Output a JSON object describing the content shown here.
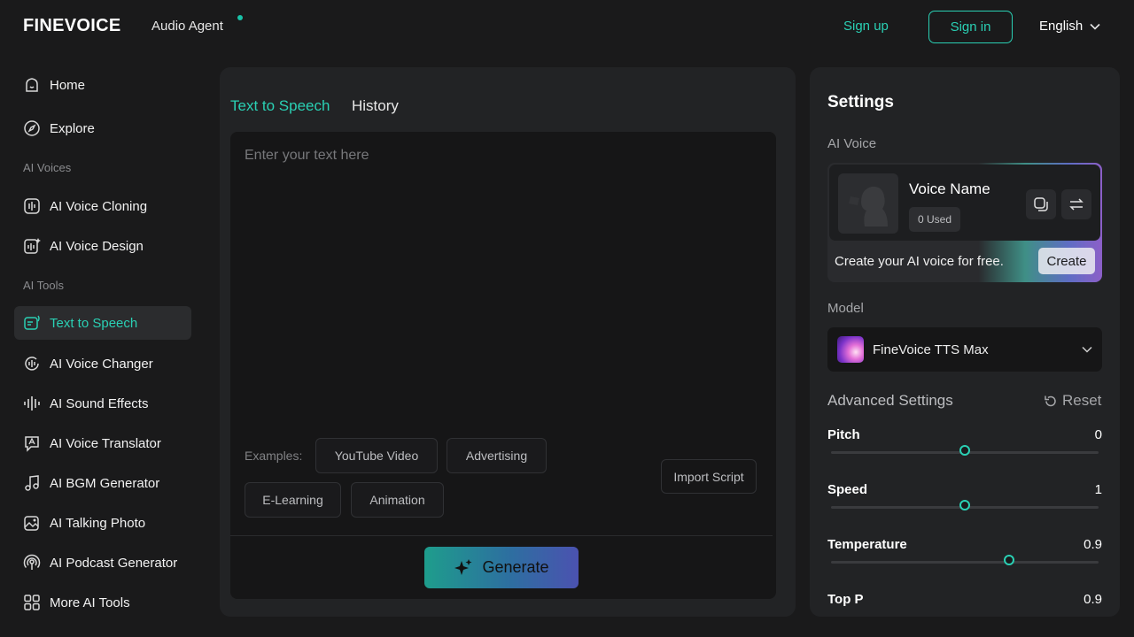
{
  "header": {
    "logo": "FINEVOICE",
    "agent_label": "Audio Agent",
    "signup_label": "Sign up",
    "signin_label": "Sign in",
    "language": "English"
  },
  "sidebar": {
    "items_top": [
      {
        "label": "Home",
        "icon": "home-icon"
      },
      {
        "label": "Explore",
        "icon": "compass-icon"
      }
    ],
    "section_voices": "AI Voices",
    "items_voices": [
      {
        "label": "AI Voice Cloning",
        "icon": "voice-clone-icon"
      },
      {
        "label": "AI Voice Design",
        "icon": "voice-design-icon"
      }
    ],
    "section_tools": "AI Tools",
    "items_tools": [
      {
        "label": "Text to Speech",
        "icon": "tts-icon",
        "active": true
      },
      {
        "label": "AI Voice Changer",
        "icon": "voice-changer-icon"
      },
      {
        "label": "AI Sound Effects",
        "icon": "sound-effects-icon"
      },
      {
        "label": "AI Voice Translator",
        "icon": "translator-icon"
      },
      {
        "label": "AI BGM Generator",
        "icon": "music-note-icon"
      },
      {
        "label": "AI Talking Photo",
        "icon": "photo-icon"
      },
      {
        "label": "AI Podcast Generator",
        "icon": "podcast-icon"
      },
      {
        "label": "More AI Tools",
        "icon": "grid-icon"
      }
    ]
  },
  "main": {
    "tabs": [
      {
        "label": "Text to Speech",
        "active": true
      },
      {
        "label": "History",
        "active": false
      }
    ],
    "placeholder": "Enter your text here",
    "examples_label": "Examples:",
    "examples": [
      "YouTube Video",
      "Advertising",
      "E-Learning",
      "Animation"
    ],
    "import_label": "Import Script",
    "generate_label": "Generate"
  },
  "settings": {
    "title": "Settings",
    "ai_voice_label": "AI Voice",
    "voice_name": "Voice Name",
    "used_badge": "0 Used",
    "create_text": "Create your AI voice for free.",
    "create_label": "Create",
    "model_label": "Model",
    "model_name": "FineVoice TTS Max",
    "advanced_label": "Advanced Settings",
    "reset_label": "Reset",
    "sliders": [
      {
        "label": "Pitch",
        "value": "0",
        "fraction": 0.5
      },
      {
        "label": "Speed",
        "value": "1",
        "fraction": 0.5
      },
      {
        "label": "Temperature",
        "value": "0.9",
        "fraction": 0.665
      },
      {
        "label": "Top P",
        "value": "0.9",
        "fraction": null
      }
    ]
  },
  "colors": {
    "accent": "#2ad0b4",
    "background": "#1a1a1b",
    "panel": "#222325"
  }
}
